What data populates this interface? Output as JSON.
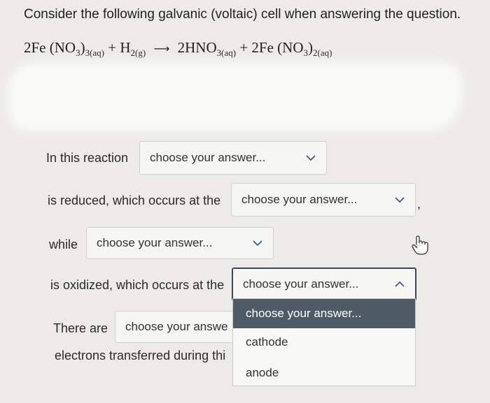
{
  "question": {
    "prompt": "Consider the following galvanic (voltaic) cell when answering the question.",
    "equation": {
      "r1_coef": "2Fe",
      "r1_body": "(NO",
      "r1_sub3": "3",
      "r1_close": ")",
      "r1_state": "3(aq)",
      "plus1": "+",
      "r2_body": "H",
      "r2_state": "2(g)",
      "arrow": "⟶",
      "p1_coef": "2HNO",
      "p1_state": "3(aq)",
      "plus2": "+",
      "p2_coef": "2Fe",
      "p2_body": "(NO",
      "p2_sub3": "3",
      "p2_close": ")",
      "p2_state": "2(aq)"
    }
  },
  "statements": {
    "line1": "In this reaction",
    "line2": "is reduced, which occurs at the",
    "line2_tail": ",",
    "line3": "while",
    "line4": "is oxidized, which occurs at the",
    "line5": "There are",
    "line6": "electrons transferred during thi"
  },
  "dropdowns": {
    "d1": "choose your answer...",
    "d2": "choose your answer...",
    "d3": "choose your answer...",
    "d4": "choose your answer...",
    "d5": "choose your answe"
  },
  "menu": {
    "options": [
      "choose your answer...",
      "cathode",
      "anode"
    ]
  },
  "icons": {
    "chevron": "chevron-down-icon",
    "chevron_up": "chevron-up-icon",
    "cursor": "hand-pointer-icon"
  },
  "colors": {
    "selected_bg": "#4e5a66",
    "focus_border": "#3a4a5c",
    "chevron": "#3f5b8a"
  }
}
